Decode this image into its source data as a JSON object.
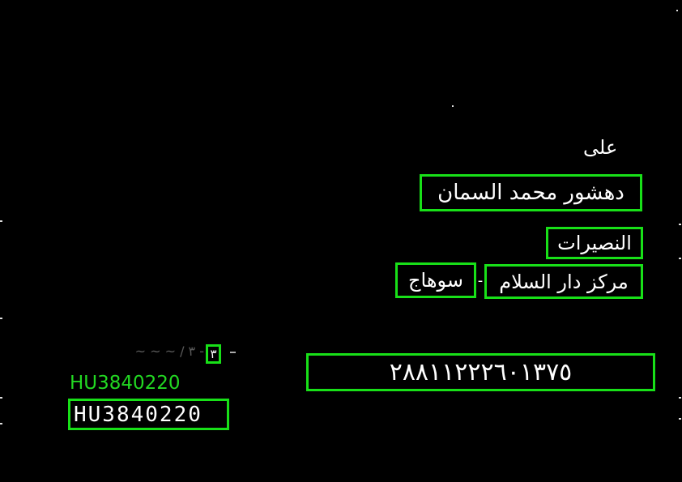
{
  "document": {
    "line_ala": "على",
    "recipient_name": "دهشور محمد السمان",
    "district": "النصيرات",
    "center": "مركز دار السلام",
    "separator": "-",
    "governorate": "سوهاج",
    "national_id": "٢٨٨١١٢٢٢٦٠١٣٧٥",
    "small_digit": "٣",
    "faded_text": "~ ~ ~ / ٣ -",
    "code_detected_label": "HU3840220",
    "code_value": "HU3840220"
  },
  "colors": {
    "background": "#000000",
    "text": "#ffffff",
    "detection_box": "#18e018",
    "detected_label": "#22d822"
  }
}
